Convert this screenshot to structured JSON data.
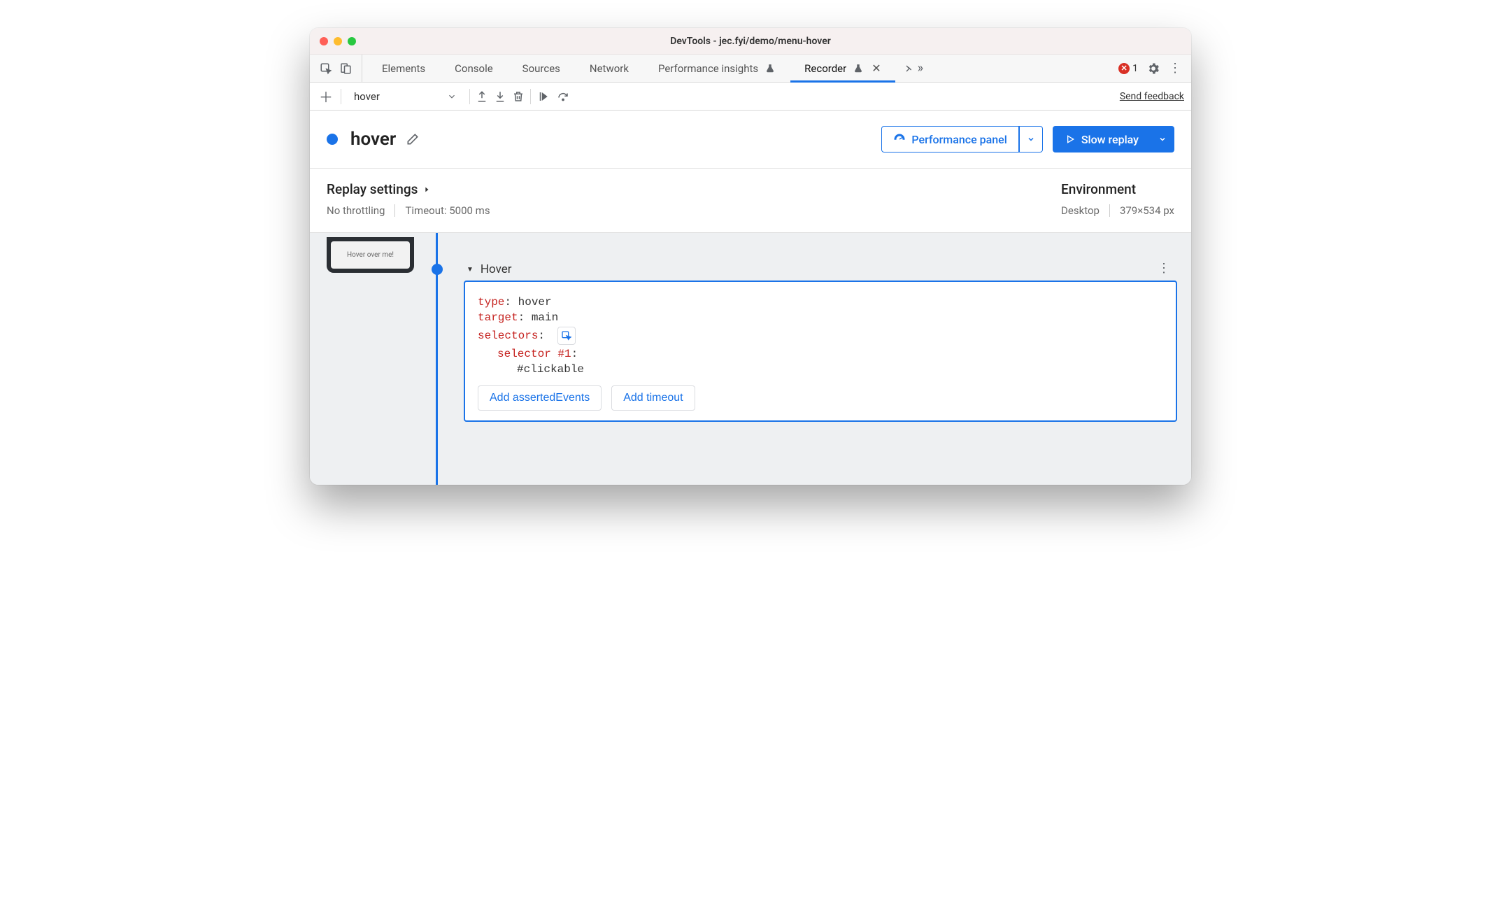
{
  "window": {
    "title": "DevTools - jec.fyi/demo/menu-hover"
  },
  "tabbar": {
    "tabs": [
      "Elements",
      "Console",
      "Sources",
      "Network",
      "Performance insights",
      "Recorder"
    ],
    "active_index": 5,
    "error_count": "1"
  },
  "toolbar": {
    "selected_recording": "hover",
    "feedback": "Send feedback"
  },
  "recording": {
    "name": "hover",
    "perf_button": "Performance panel",
    "replay_button": "Slow replay"
  },
  "settings": {
    "title": "Replay settings",
    "throttling": "No throttling",
    "timeout": "Timeout: 5000 ms",
    "env_title": "Environment",
    "env_device": "Desktop",
    "env_size": "379×534 px"
  },
  "thumbnail": {
    "text": "Hover over me!"
  },
  "step": {
    "title": "Hover",
    "type_key": "type",
    "type_val": "hover",
    "target_key": "target",
    "target_val": "main",
    "selectors_key": "selectors",
    "selector_label": "selector #1",
    "selector_value": "#clickable",
    "add_asserted": "Add assertedEvents",
    "add_timeout": "Add timeout"
  }
}
